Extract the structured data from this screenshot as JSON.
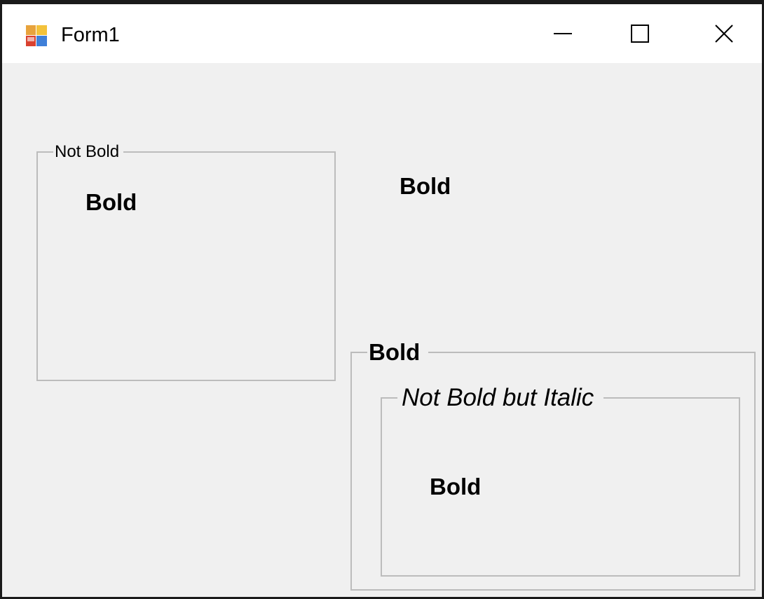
{
  "window": {
    "title": "Form1",
    "app_icon": "winforms-app-icon",
    "controls": {
      "minimize_icon": "minimize-icon",
      "maximize_icon": "maximize-icon",
      "close_icon": "close-icon"
    }
  },
  "group1": {
    "caption": "Not Bold",
    "inner_label": "Bold"
  },
  "standalone_label": "Bold",
  "group2": {
    "caption": "Bold",
    "inner_group": {
      "caption": "Not Bold but Italic",
      "inner_label": "Bold"
    }
  },
  "colors": {
    "client_bg": "#f0f0f0",
    "titlebar_bg": "#ffffff",
    "groupbox_border": "#bcbcbc",
    "window_border": "#1a1a1a"
  }
}
